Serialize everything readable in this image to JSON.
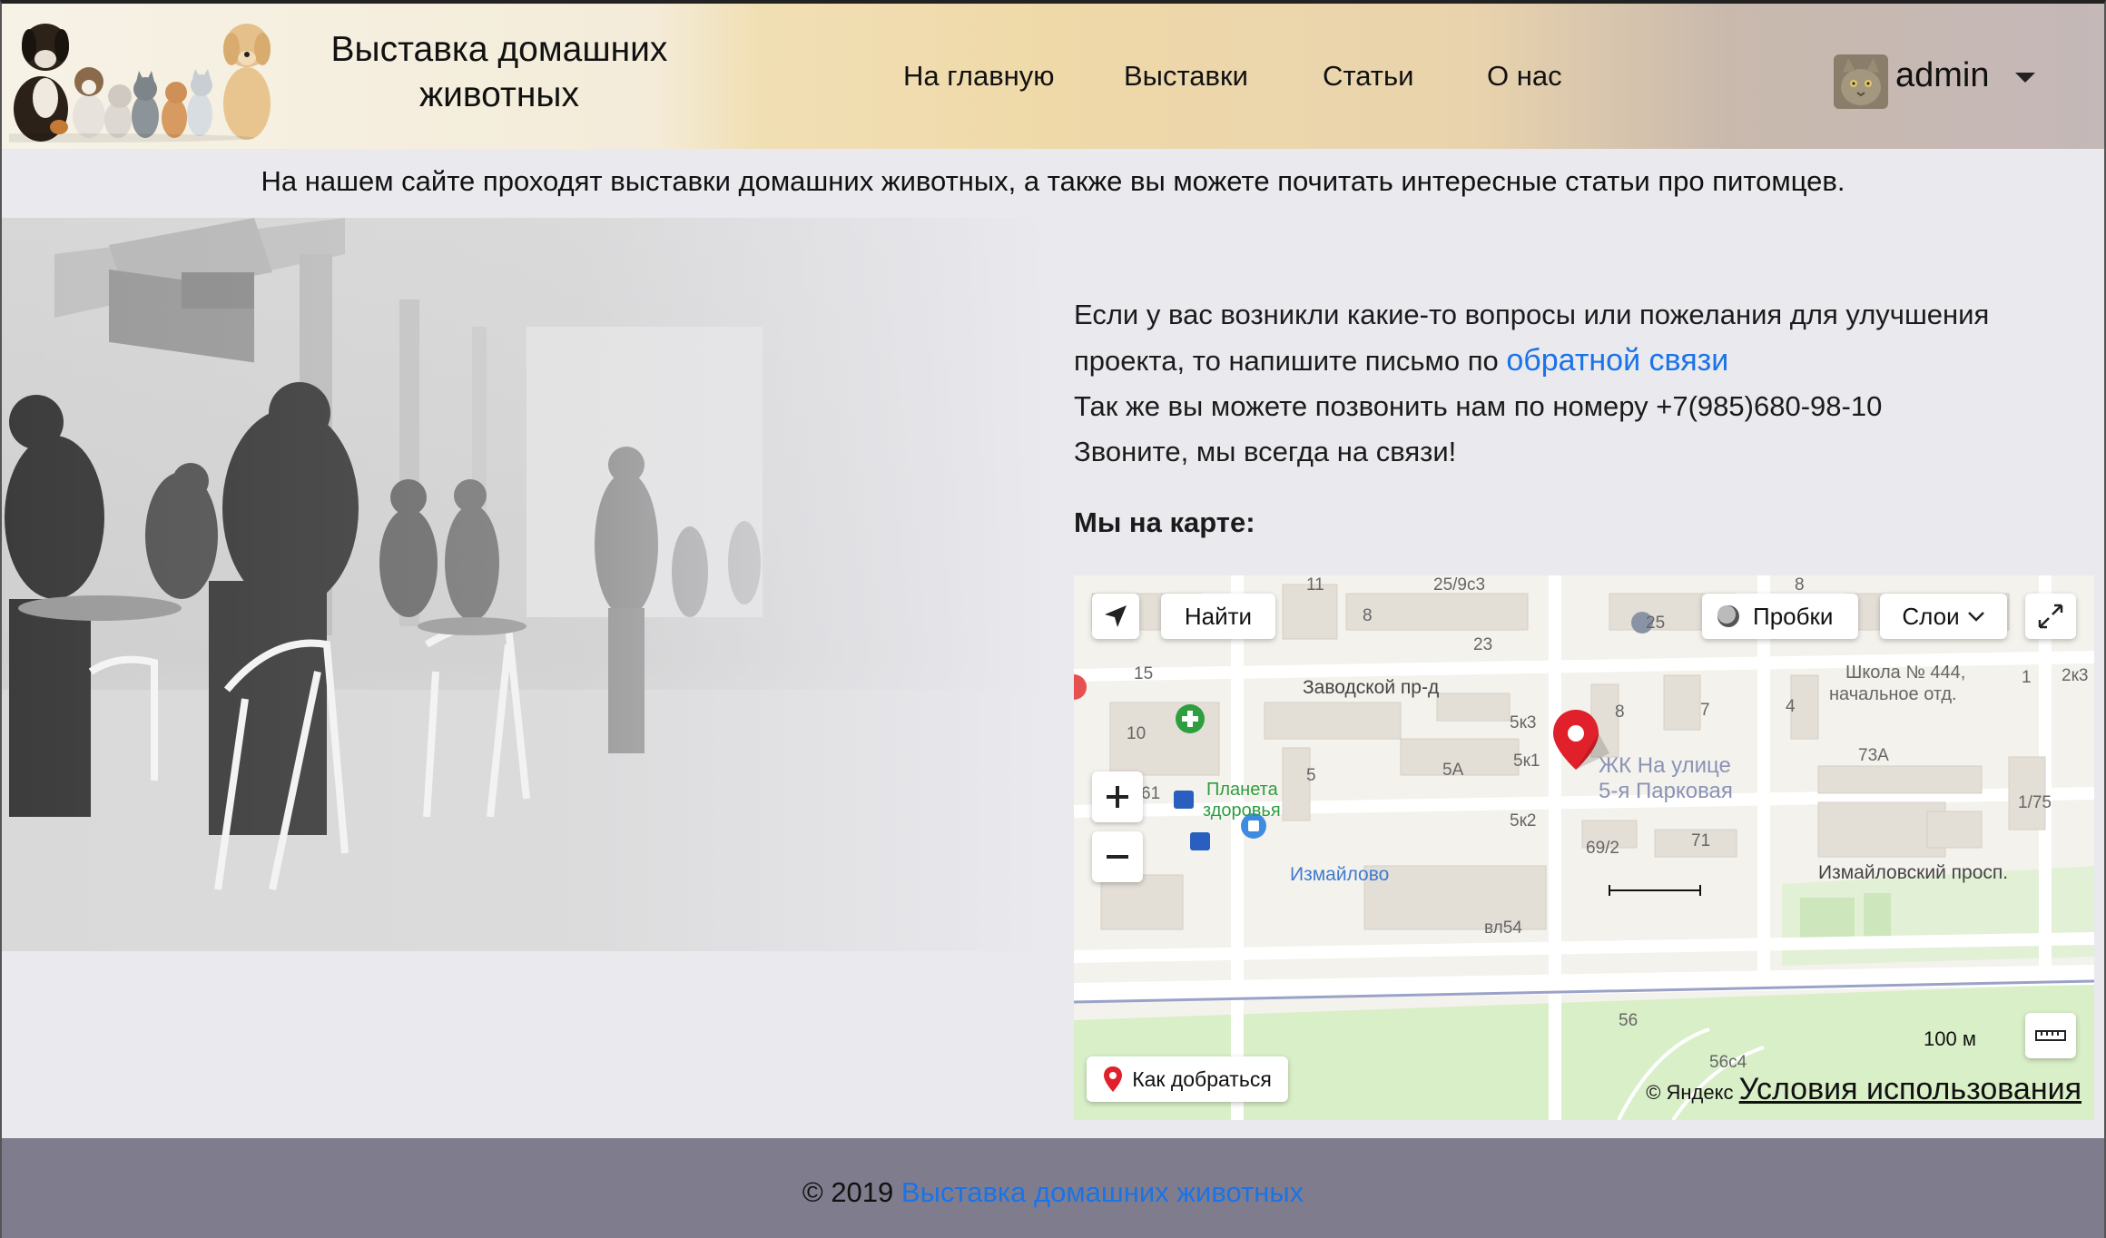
{
  "header": {
    "title_line1": "Выставка домашних",
    "title_line2": "животных",
    "nav": [
      {
        "label": "На главную"
      },
      {
        "label": "Выставки"
      },
      {
        "label": "Статьи"
      },
      {
        "label": "О нас"
      }
    ],
    "user": {
      "name": "admin"
    }
  },
  "intro": "На нашем сайте проходят выставки домашних животных, а также вы можете почитать интересные статьи про питомцев.",
  "contact": {
    "line1": "Если у вас возникли какие-то вопросы или пожелания для улучшения",
    "line2_prefix": "проекта, то напишите письмо по ",
    "feedback_link": "обратной связи",
    "line3": "Так же вы можете позвонить нам по номеру +7(985)680-98-10",
    "line4": "Звоните, мы всегда на связи!"
  },
  "map": {
    "title": "Мы на карте:",
    "find_button": "Найти",
    "traffic_button": "Пробки",
    "layers_button": "Слои",
    "route_button": "Как добраться",
    "scale": "100 м",
    "copyright": "© Яндекс",
    "terms_link": "Условия использования",
    "labels": {
      "street1": "Заводской пр-д",
      "street2": "Измайловский просп.",
      "school": "Школа № 444,",
      "school2": "начальное отд.",
      "complex1": "ЖК На улице",
      "complex2": "5-я Парковая",
      "pharmacy1": "Планета",
      "pharmacy2": "здоровья",
      "station": "Измайлово",
      "b11": "11",
      "b25_9": "25/9с3",
      "b8a": "8",
      "b8b": "8",
      "b25": "25",
      "b23": "23",
      "b15": "15",
      "b10": "10",
      "b61": "61",
      "b5": "5",
      "b5a": "5А",
      "b5k3": "5к3",
      "b5k1": "5к1",
      "b5k2": "5к2",
      "b8c": "8",
      "b7": "7",
      "b4": "4",
      "b73a": "73А",
      "b1_75": "1/75",
      "b69_2": "69/2",
      "b71": "71",
      "bvl54": "вл54",
      "b56": "56",
      "b56c4": "56с4",
      "b2k3": "2к3",
      "b1": "1"
    }
  },
  "footer": {
    "copyright": "© 2019 ",
    "link": "Выставка домашних животных"
  },
  "colors": {
    "link": "#1a73e8",
    "footer_bg": "#7f7d8d",
    "page_bg": "#e9e9ee",
    "map_pin": "#e0202a",
    "pharmacy": "#2e9e3e",
    "park": "#d9efc8"
  }
}
